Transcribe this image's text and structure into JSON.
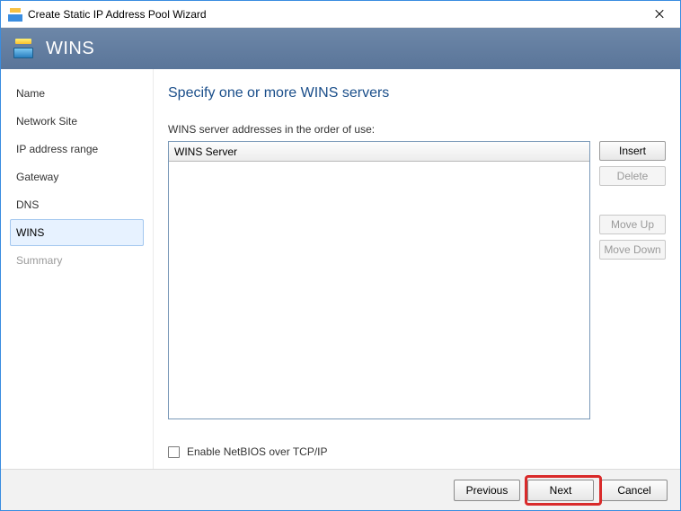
{
  "titlebar": {
    "title": "Create Static IP Address Pool Wizard"
  },
  "banner": {
    "title": "WINS"
  },
  "sidebar": {
    "items": [
      {
        "label": "Name",
        "state": "normal"
      },
      {
        "label": "Network Site",
        "state": "normal"
      },
      {
        "label": "IP address range",
        "state": "normal"
      },
      {
        "label": "Gateway",
        "state": "normal"
      },
      {
        "label": "DNS",
        "state": "normal"
      },
      {
        "label": "WINS",
        "state": "selected"
      },
      {
        "label": "Summary",
        "state": "disabled"
      }
    ]
  },
  "main": {
    "heading": "Specify one or more WINS servers",
    "instruction": "WINS server addresses in the order of use:",
    "grid_header": "WINS Server",
    "buttons": {
      "insert": {
        "label": "Insert",
        "disabled": false
      },
      "delete": {
        "label": "Delete",
        "disabled": true
      },
      "moveup": {
        "label": "Move Up",
        "disabled": true
      },
      "movedown": {
        "label": "Move Down",
        "disabled": true
      }
    },
    "checkbox": {
      "label": "Enable NetBIOS over TCP/IP",
      "checked": false
    }
  },
  "footer": {
    "previous": "Previous",
    "next": "Next",
    "cancel": "Cancel"
  }
}
